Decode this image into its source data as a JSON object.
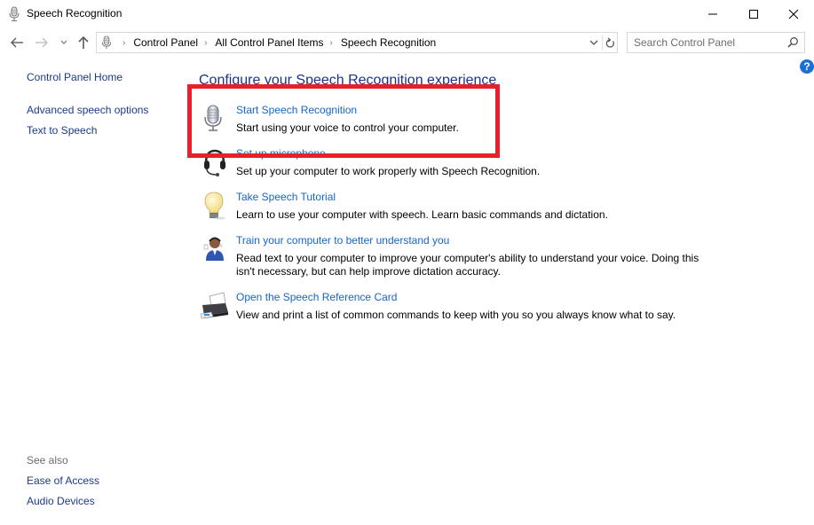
{
  "window": {
    "title": "Speech Recognition",
    "icon": "microphone-icon",
    "controls": {
      "minimize": "minimize-icon",
      "maximize": "maximize-icon",
      "close": "close-icon"
    }
  },
  "navigation": {
    "back_icon": "arrow-left-icon",
    "forward_icon": "arrow-right-icon",
    "recent_icon": "chevron-down-icon",
    "up_icon": "arrow-up-icon",
    "breadcrumb": [
      "Control Panel",
      "All Control Panel Items",
      "Speech Recognition"
    ],
    "breadcrumb_separator": "›",
    "dropdown_icon": "chevron-down-icon",
    "refresh_icon": "refresh-icon",
    "search": {
      "placeholder": "Search Control Panel",
      "value": "",
      "icon": "search-icon"
    },
    "help_label": "?"
  },
  "sidebar": {
    "home": "Control Panel Home",
    "links": [
      "Advanced speech options",
      "Text to Speech"
    ],
    "see_also_label": "See also",
    "see_also": [
      "Ease of Access",
      "Audio Devices"
    ]
  },
  "main": {
    "heading": "Configure your Speech Recognition experience",
    "tasks": [
      {
        "icon": "microphone-icon",
        "link": "Start Speech Recognition",
        "description": "Start using your voice to control your computer."
      },
      {
        "icon": "headset-icon",
        "link": "Set up microphone",
        "description": "Set up your computer to work properly with Speech Recognition."
      },
      {
        "icon": "lightbulb-icon",
        "link": "Take Speech Tutorial",
        "description": "Learn to use your computer with speech.  Learn basic commands and dictation."
      },
      {
        "icon": "user-headset-icon",
        "link": "Train your computer to better understand you",
        "description": "Read text to your computer to improve your computer's ability to understand your voice.  Doing this isn't necessary, but can help improve dictation accuracy."
      },
      {
        "icon": "printer-icon",
        "link": "Open the Speech Reference Card",
        "description": "View and print a list of common commands to keep with you so you always know what to say."
      }
    ]
  },
  "annotation": {
    "highlight_color": "#e8202a",
    "highlighted_task": "Start Speech Recognition"
  },
  "colors": {
    "link": "#1566c9",
    "sidebar_link": "#1a3a8a",
    "heading": "#1e3287",
    "help": "#1e6fd4"
  }
}
